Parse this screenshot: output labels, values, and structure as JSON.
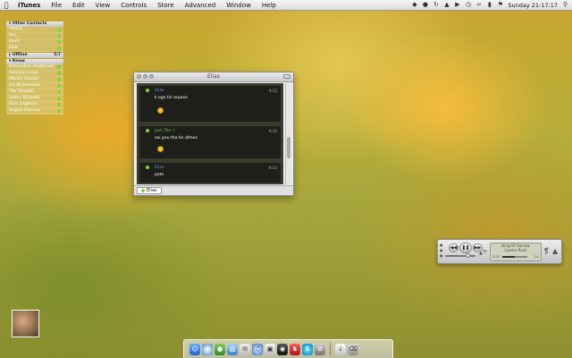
{
  "menubar": {
    "app_name": "iTunes",
    "items": [
      "File",
      "Edit",
      "View",
      "Controls",
      "Store",
      "Advanced",
      "Window",
      "Help"
    ],
    "clock": "Sunday 21:17:17"
  },
  "contacts": {
    "groups": [
      {
        "name": "Other Contacts",
        "count": "",
        "contacts": [
          "PANOS",
          "Kos",
          "denis",
          "Elias"
        ]
      },
      {
        "name": "Offline",
        "count": "5/7",
        "contacts": []
      },
      {
        "name": "Know",
        "count": "",
        "contacts": [
          "Alexandros Vergetnaki",
          "Georgia Grega",
          "Marilia Oikolak",
          "Evi Michaelidou",
          "Tito Tsinalati",
          "Sotiris Kyriaidis",
          "Elias Zaganas",
          "Angelo Giannas"
        ]
      }
    ]
  },
  "chat": {
    "title": "Elias",
    "messages": [
      {
        "sender": "Elias",
        "time": "9:12",
        "text": "k ego tin arpaxa",
        "emoji": true
      },
      {
        "sender": "Just_Tee !!",
        "time": "9:12",
        "text": "oxi pou tha tin afmes",
        "emoji": true
      },
      {
        "sender": "Elias",
        "time": "9:13",
        "text": "pote",
        "emoji": false
      }
    ],
    "tab_label": "Elias"
  },
  "miniplayer": {
    "track_title": "King Of Sorrow",
    "artist": "Lovers Rock",
    "elapsed": "3:22",
    "remaining": "3:1",
    "progress_fraction": 0.5,
    "volume_fraction": 0.75
  },
  "dock": {
    "icons": [
      "finder-icon",
      "safari-icon",
      "adium-icon",
      "preview-icon",
      "mail-icon",
      "itunes-icon",
      "photos-icon",
      "camera-icon",
      "chess-icon",
      "skype-icon",
      "utility-icon",
      "downloads-icon",
      "trash-icon"
    ]
  }
}
